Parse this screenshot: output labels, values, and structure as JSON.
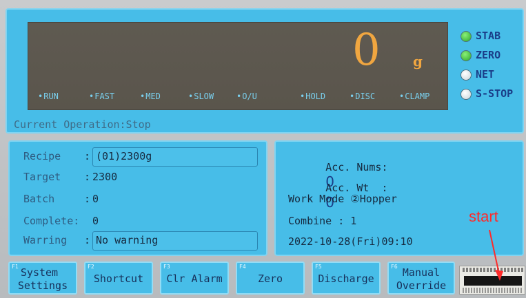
{
  "display": {
    "weight": "0",
    "unit": "g",
    "status_lights": [
      "RUN",
      "FAST",
      "MED",
      "SLOW",
      "O/U",
      "HOLD",
      "DISC",
      "CLAMP"
    ]
  },
  "indicators": [
    {
      "label": "STAB",
      "state": "on",
      "color": "#3dbf35"
    },
    {
      "label": "ZERO",
      "state": "on",
      "color": "#3dbf35"
    },
    {
      "label": "NET",
      "state": "off",
      "color": "#e4ecf0"
    },
    {
      "label": "S-STOP",
      "state": "off",
      "color": "#e4ecf0"
    }
  ],
  "current_operation": "Current Operation:Stop",
  "left_info": {
    "recipe_label": "Recipe",
    "recipe_value": "(01)2300g",
    "target_label": "Target",
    "target_value": "2300",
    "batch_label": "Batch",
    "batch_value": "0",
    "complete_label": "Complete:",
    "complete_value": "0",
    "warring_label": "Warring",
    "warring_value": "No warning"
  },
  "right_info": {
    "acc_nums_label": "Acc. Nums:",
    "acc_nums_value": "0",
    "acc_wt_label": "Acc. Wt  :",
    "acc_wt_value": "0",
    "work_mode": "Work Mode ②Hopper",
    "combine": "Combine : 1",
    "datetime": "2022-10-28(Fri)09:10"
  },
  "fkeys": [
    {
      "num": "F1",
      "line1": "System",
      "line2": "Settings"
    },
    {
      "num": "F2",
      "line1": "Shortcut",
      "line2": ""
    },
    {
      "num": "F3",
      "line1": "Clr Alarm",
      "line2": ""
    },
    {
      "num": "F4",
      "line1": "Zero",
      "line2": ""
    },
    {
      "num": "F5",
      "line1": "Discharge",
      "line2": ""
    },
    {
      "num": "F6",
      "line1": "Manual",
      "line2": "Override"
    }
  ],
  "annotation": "start",
  "colors": {
    "panel": "#47bde8",
    "display_bg": "#5d5850",
    "digit": "#f0a640",
    "annotation": "#ff2a2a"
  }
}
